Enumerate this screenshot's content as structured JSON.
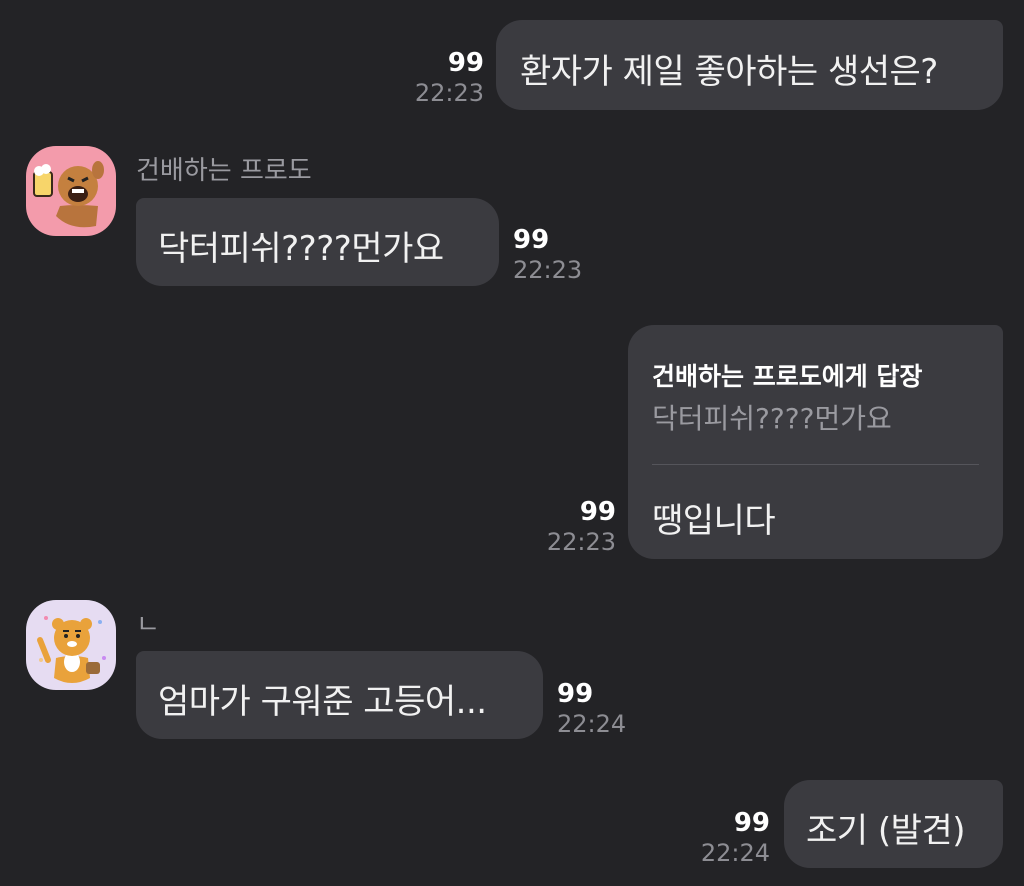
{
  "messages": [
    {
      "dir": "out",
      "text": "환자가 제일 좋아하는 생선은?",
      "count": "99",
      "time": "22:23"
    },
    {
      "dir": "in",
      "sender": "건배하는 프로도",
      "text": "닥터피쉬????먼가요",
      "count": "99",
      "time": "22:23"
    },
    {
      "dir": "out",
      "reply_to": "건배하는 프로도에게 답장",
      "reply_quote": "닥터피쉬????먼가요",
      "text": "땡입니다",
      "count": "99",
      "time": "22:23"
    },
    {
      "dir": "in",
      "sender": "ㄴ",
      "text": "엄마가 구워준 고등어...",
      "count": "99",
      "time": "22:24"
    },
    {
      "dir": "out",
      "text": "조기 (발견)",
      "count": "99",
      "time": "22:24"
    }
  ],
  "colors": {
    "background": "#232326",
    "bubble": "#3b3b40",
    "avatar1_bg": "#f39bab",
    "avatar2_bg": "#e6dcf2"
  },
  "avatars": [
    "frodo-beer-avatar-icon",
    "ryan-avatar-icon"
  ]
}
